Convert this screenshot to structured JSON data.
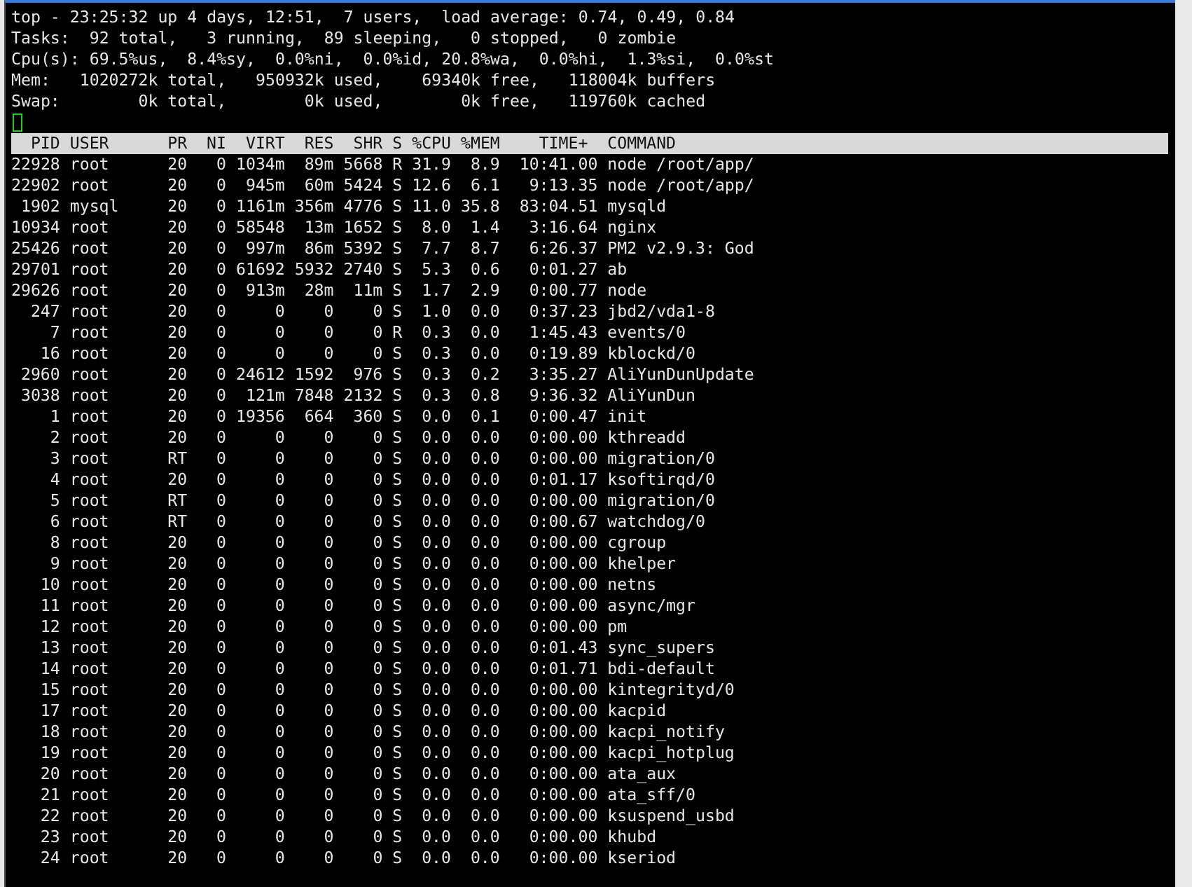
{
  "summary": [
    "top - 23:25:32 up 4 days, 12:51,  7 users,  load average: 0.74, 0.49, 0.84",
    "Tasks:  92 total,   3 running,  89 sleeping,   0 stopped,   0 zombie",
    "Cpu(s): 69.5%us,  8.4%sy,  0.0%ni,  0.0%id, 20.8%wa,  0.0%hi,  1.3%si,  0.0%st",
    "Mem:   1020272k total,   950932k used,    69340k free,   118004k buffers",
    "Swap:        0k total,        0k used,        0k free,   119760k cached"
  ],
  "table": {
    "columns": [
      "PID",
      "USER",
      "PR",
      "NI",
      "VIRT",
      "RES",
      "SHR",
      "S",
      "%CPU",
      "%MEM",
      "TIME+",
      "COMMAND"
    ],
    "rows": [
      [
        "22928",
        "root",
        "20",
        "0",
        "1034m",
        "89m",
        "5668",
        "R",
        "31.9",
        "8.9",
        "10:41.00",
        "node /root/app/"
      ],
      [
        "22902",
        "root",
        "20",
        "0",
        "945m",
        "60m",
        "5424",
        "S",
        "12.6",
        "6.1",
        "9:13.35",
        "node /root/app/"
      ],
      [
        "1902",
        "mysql",
        "20",
        "0",
        "1161m",
        "356m",
        "4776",
        "S",
        "11.0",
        "35.8",
        "83:04.51",
        "mysqld"
      ],
      [
        "10934",
        "root",
        "20",
        "0",
        "58548",
        "13m",
        "1652",
        "S",
        "8.0",
        "1.4",
        "3:16.64",
        "nginx"
      ],
      [
        "25426",
        "root",
        "20",
        "0",
        "997m",
        "86m",
        "5392",
        "S",
        "7.7",
        "8.7",
        "6:26.37",
        "PM2 v2.9.3: God"
      ],
      [
        "29701",
        "root",
        "20",
        "0",
        "61692",
        "5932",
        "2740",
        "S",
        "5.3",
        "0.6",
        "0:01.27",
        "ab"
      ],
      [
        "29626",
        "root",
        "20",
        "0",
        "913m",
        "28m",
        "11m",
        "S",
        "1.7",
        "2.9",
        "0:00.77",
        "node"
      ],
      [
        "247",
        "root",
        "20",
        "0",
        "0",
        "0",
        "0",
        "S",
        "1.0",
        "0.0",
        "0:37.23",
        "jbd2/vda1-8"
      ],
      [
        "7",
        "root",
        "20",
        "0",
        "0",
        "0",
        "0",
        "R",
        "0.3",
        "0.0",
        "1:45.43",
        "events/0"
      ],
      [
        "16",
        "root",
        "20",
        "0",
        "0",
        "0",
        "0",
        "S",
        "0.3",
        "0.0",
        "0:19.89",
        "kblockd/0"
      ],
      [
        "2960",
        "root",
        "20",
        "0",
        "24612",
        "1592",
        "976",
        "S",
        "0.3",
        "0.2",
        "3:35.27",
        "AliYunDunUpdate"
      ],
      [
        "3038",
        "root",
        "20",
        "0",
        "121m",
        "7848",
        "2132",
        "S",
        "0.3",
        "0.8",
        "9:36.32",
        "AliYunDun"
      ],
      [
        "1",
        "root",
        "20",
        "0",
        "19356",
        "664",
        "360",
        "S",
        "0.0",
        "0.1",
        "0:00.47",
        "init"
      ],
      [
        "2",
        "root",
        "20",
        "0",
        "0",
        "0",
        "0",
        "S",
        "0.0",
        "0.0",
        "0:00.00",
        "kthreadd"
      ],
      [
        "3",
        "root",
        "RT",
        "0",
        "0",
        "0",
        "0",
        "S",
        "0.0",
        "0.0",
        "0:00.00",
        "migration/0"
      ],
      [
        "4",
        "root",
        "20",
        "0",
        "0",
        "0",
        "0",
        "S",
        "0.0",
        "0.0",
        "0:01.17",
        "ksoftirqd/0"
      ],
      [
        "5",
        "root",
        "RT",
        "0",
        "0",
        "0",
        "0",
        "S",
        "0.0",
        "0.0",
        "0:00.00",
        "migration/0"
      ],
      [
        "6",
        "root",
        "RT",
        "0",
        "0",
        "0",
        "0",
        "S",
        "0.0",
        "0.0",
        "0:00.67",
        "watchdog/0"
      ],
      [
        "8",
        "root",
        "20",
        "0",
        "0",
        "0",
        "0",
        "S",
        "0.0",
        "0.0",
        "0:00.00",
        "cgroup"
      ],
      [
        "9",
        "root",
        "20",
        "0",
        "0",
        "0",
        "0",
        "S",
        "0.0",
        "0.0",
        "0:00.00",
        "khelper"
      ],
      [
        "10",
        "root",
        "20",
        "0",
        "0",
        "0",
        "0",
        "S",
        "0.0",
        "0.0",
        "0:00.00",
        "netns"
      ],
      [
        "11",
        "root",
        "20",
        "0",
        "0",
        "0",
        "0",
        "S",
        "0.0",
        "0.0",
        "0:00.00",
        "async/mgr"
      ],
      [
        "12",
        "root",
        "20",
        "0",
        "0",
        "0",
        "0",
        "S",
        "0.0",
        "0.0",
        "0:00.00",
        "pm"
      ],
      [
        "13",
        "root",
        "20",
        "0",
        "0",
        "0",
        "0",
        "S",
        "0.0",
        "0.0",
        "0:01.43",
        "sync_supers"
      ],
      [
        "14",
        "root",
        "20",
        "0",
        "0",
        "0",
        "0",
        "S",
        "0.0",
        "0.0",
        "0:01.71",
        "bdi-default"
      ],
      [
        "15",
        "root",
        "20",
        "0",
        "0",
        "0",
        "0",
        "S",
        "0.0",
        "0.0",
        "0:00.00",
        "kintegrityd/0"
      ],
      [
        "17",
        "root",
        "20",
        "0",
        "0",
        "0",
        "0",
        "S",
        "0.0",
        "0.0",
        "0:00.00",
        "kacpid"
      ],
      [
        "18",
        "root",
        "20",
        "0",
        "0",
        "0",
        "0",
        "S",
        "0.0",
        "0.0",
        "0:00.00",
        "kacpi_notify"
      ],
      [
        "19",
        "root",
        "20",
        "0",
        "0",
        "0",
        "0",
        "S",
        "0.0",
        "0.0",
        "0:00.00",
        "kacpi_hotplug"
      ],
      [
        "20",
        "root",
        "20",
        "0",
        "0",
        "0",
        "0",
        "S",
        "0.0",
        "0.0",
        "0:00.00",
        "ata_aux"
      ],
      [
        "21",
        "root",
        "20",
        "0",
        "0",
        "0",
        "0",
        "S",
        "0.0",
        "0.0",
        "0:00.00",
        "ata_sff/0"
      ],
      [
        "22",
        "root",
        "20",
        "0",
        "0",
        "0",
        "0",
        "S",
        "0.0",
        "0.0",
        "0:00.00",
        "ksuspend_usbd"
      ],
      [
        "23",
        "root",
        "20",
        "0",
        "0",
        "0",
        "0",
        "S",
        "0.0",
        "0.0",
        "0:00.00",
        "khubd"
      ],
      [
        "24",
        "root",
        "20",
        "0",
        "0",
        "0",
        "0",
        "S",
        "0.0",
        "0.0",
        "0:00.00",
        "kseriod"
      ]
    ]
  }
}
